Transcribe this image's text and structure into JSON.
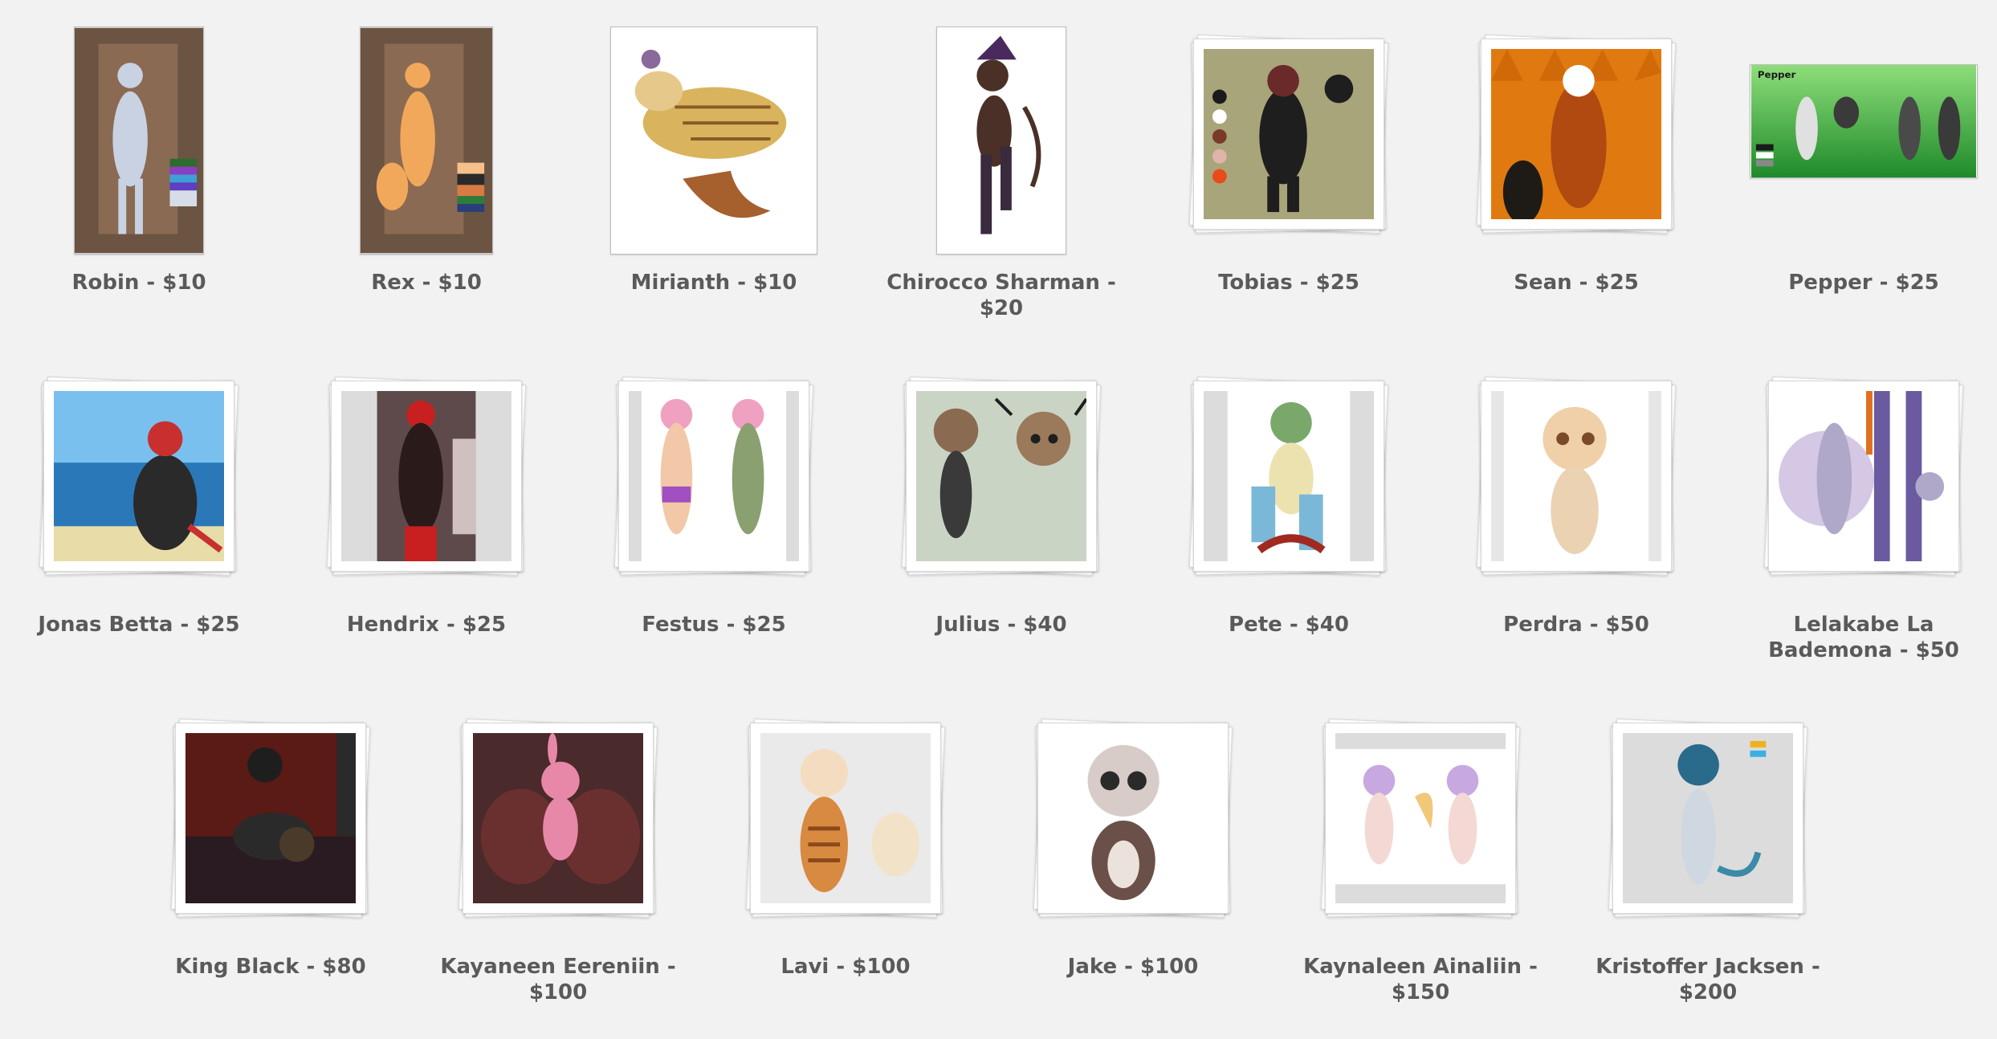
{
  "gallery": {
    "items": [
      {
        "label": "Robin - $10",
        "art": "robin-art"
      },
      {
        "label": "Rex - $10",
        "art": "rex-art"
      },
      {
        "label": "Mirianth - $10",
        "art": "mirianth-art"
      },
      {
        "label": "Chirocco Sharman - $20",
        "art": "chirocco-art"
      },
      {
        "label": "Tobias - $25",
        "art": "tobias-art"
      },
      {
        "label": "Sean - $25",
        "art": "sean-art"
      },
      {
        "label": "Pepper - $25",
        "art": "pepper-art",
        "art_text": "Pepper"
      },
      {
        "label": "Jonas Betta - $25",
        "art": "jonas-art"
      },
      {
        "label": "Hendrix - $25",
        "art": "hendrix-art"
      },
      {
        "label": "Festus - $25",
        "art": "festus-art"
      },
      {
        "label": "Julius - $40",
        "art": "julius-art"
      },
      {
        "label": "Pete - $40",
        "art": "pete-art"
      },
      {
        "label": "Perdra - $50",
        "art": "perdra-art"
      },
      {
        "label": "Lelakabe La Bademona - $50",
        "art": "lelakabe-art"
      },
      {
        "label": "King Black - $80",
        "art": "king-black-art"
      },
      {
        "label": "Kayaneen Eereniin - $100",
        "art": "kayaneen-art"
      },
      {
        "label": "Lavi - $100",
        "art": "lavi-art"
      },
      {
        "label": "Jake - $100",
        "art": "jake-art"
      },
      {
        "label": "Kaynaleen Ainaliin - $150",
        "art": "kaynaleen-art"
      },
      {
        "label": "Kristoffer Jacksen - $200",
        "art": "kristoffer-art"
      }
    ]
  },
  "colors": {
    "background": "#f2f2f2",
    "caption": "#5a5a5a"
  }
}
